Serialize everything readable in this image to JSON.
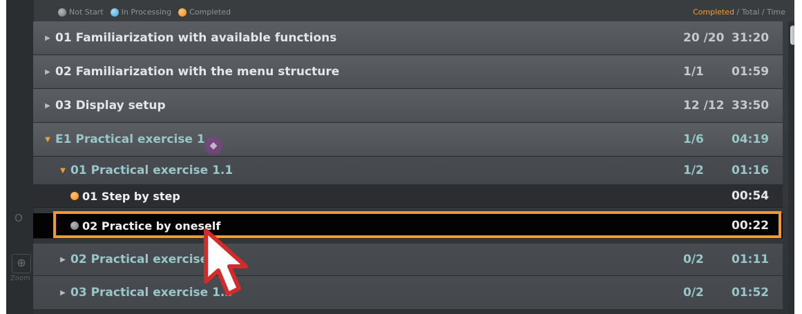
{
  "legend": {
    "not_start": "Not Start",
    "in_processing": "In Processing",
    "completed": "Completed",
    "header_completed": "Completed",
    "header_rest": " / Total / Time"
  },
  "rows": [
    {
      "title": "01 Familiarization with available functions",
      "count": "20 /20",
      "time": "31:20"
    },
    {
      "title": "02 Familiarization with the menu structure",
      "count": "1/1",
      "time": "01:59"
    },
    {
      "title": "03 Display setup",
      "count": "12 /12",
      "time": "33:50"
    },
    {
      "title": "E1 Practical exercise 1",
      "count": "1/6",
      "time": "04:19"
    },
    {
      "title": "01 Practical exercise 1.1",
      "count": "1/2",
      "time": "01:16"
    },
    {
      "title": "01 Step by step",
      "time": "00:54",
      "status": "completed"
    },
    {
      "title": "02 Practice by oneself",
      "time": "00:22",
      "status": "not-start"
    },
    {
      "title": "02 Practical exercise 1.2",
      "count": "0/2",
      "time": "01:11"
    },
    {
      "title": "03 Practical exercise 1.3",
      "count": "0/2",
      "time": "01:52"
    }
  ],
  "side": {
    "zoom_label": "Zoom",
    "zoom_icon": "zoom-in-icon",
    "ghost_letter": "O"
  },
  "colors": {
    "accent_orange": "#f29a2e",
    "teal_text": "#98c6c9",
    "row_bg": "#55595d"
  }
}
